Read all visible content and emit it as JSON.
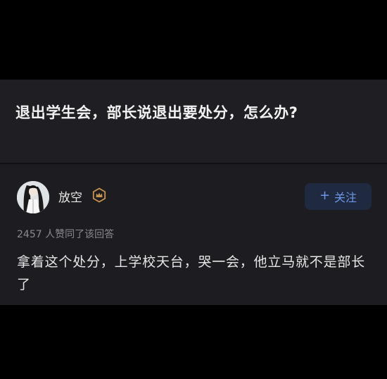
{
  "question": {
    "title": "退出学生会，部长说退出要处分，怎么办?"
  },
  "answer": {
    "author": {
      "name": "放空",
      "avatar_icon": "avatar-illustration",
      "badge_icon": "crown-badge-icon"
    },
    "follow_button": {
      "plus": "+",
      "label": "关注"
    },
    "upvote_text": "2457 人赞同了该回答",
    "content": "拿着这个处分，上学校天台，哭一会，他立马就不是部长了"
  },
  "colors": {
    "background": "#000000",
    "card": "#1c1c21",
    "accent": "#6d97ea",
    "follow_bg": "#1f2a40",
    "badge": "#c9944f",
    "muted_text": "#8a8a8f"
  }
}
